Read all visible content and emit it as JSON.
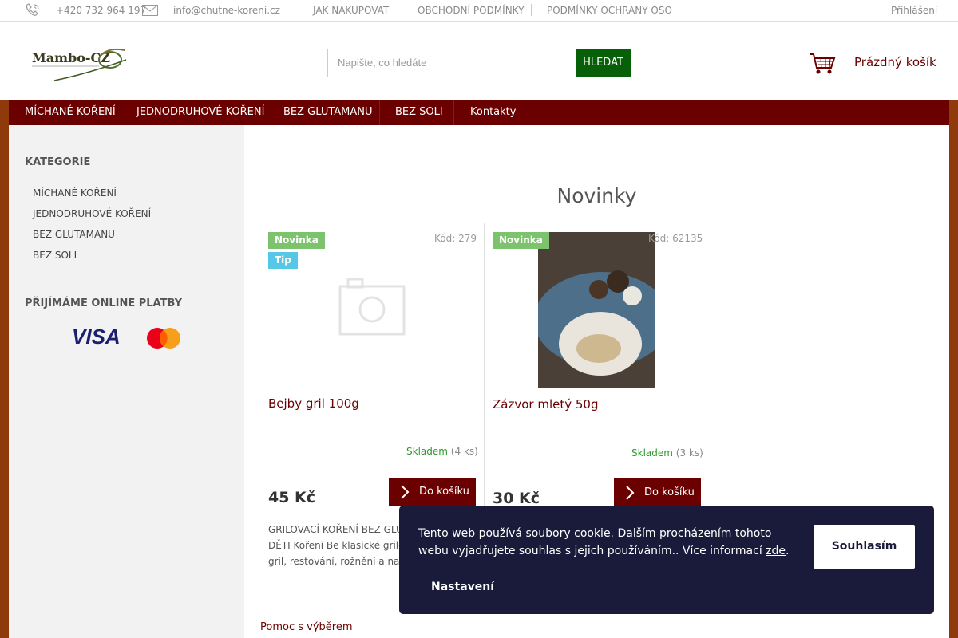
{
  "topbar": {
    "phone": "+420 732 964 197",
    "email": "info@chutne-koreni.cz",
    "links": [
      "JAK NAKUPOVAT",
      "OBCHODNÍ PODMÍNKY",
      "PODMÍNKY OCHRANY OSO"
    ],
    "login": "Přihlášení"
  },
  "header": {
    "logo_text": "Mambo-CZ",
    "search_placeholder": "Napište, co hledáte",
    "search_button": "HLEDAT",
    "cart_label": "Prázdný košík"
  },
  "nav": {
    "items": [
      "MÍCHANÉ KOŘENÍ",
      "JEDNODRUHOVÉ KOŘENÍ",
      "BEZ GLUTAMANU",
      "BEZ SOLI",
      "Kontakty"
    ]
  },
  "sidebar": {
    "categories_title": "KATEGORIE",
    "categories": [
      "MÍCHANÉ KOŘENÍ",
      "JEDNODRUHOVÉ KOŘENÍ",
      "BEZ GLUTAMANU",
      "BEZ SOLI"
    ],
    "payments_title": "PŘIJÍMÁME ONLINE PLATBY",
    "visa": "VISA"
  },
  "main": {
    "title": "Novinky",
    "products": [
      {
        "badges": [
          "Novinka",
          "Tip"
        ],
        "code": "Kód: 279",
        "name": "Bejby gril 100g",
        "stock_status": "Skladem",
        "stock_count": "(4 ks)",
        "price": "45 Kč",
        "button": "Do košíku"
      },
      {
        "badges": [
          "Novinka"
        ],
        "code": "Kód: 62135",
        "name": "Zázvor mletý 50g",
        "stock_status": "Skladem",
        "stock_count": "(3 ks)",
        "price": "30 Kč",
        "button": "Do košíku"
      }
    ],
    "description_partial": "GRILOVACÍ KOŘENÍ BEZ GLU VHODNÉ PRO DĚTI Koření Be klasické grilovací koření, vh gril, restování, rožnění a na",
    "help_image_alt": "Pomoc s výběrem"
  },
  "cookie": {
    "text": "Tento web používá soubory cookie. Dalším procházením tohoto webu vyjadřujete souhlas s jejich používáním.. Více informací",
    "link": "zde",
    "period": ".",
    "agree": "Souhlasím",
    "settings": "Nastavení"
  },
  "colors": {
    "brand_dark_red": "#6b0000",
    "search_green": "#075f07",
    "page_background": "#8f3a0a",
    "badge_new": "#7dc36d",
    "badge_tip": "#56c7e6",
    "cookie_bg": "#1a1a3a"
  }
}
